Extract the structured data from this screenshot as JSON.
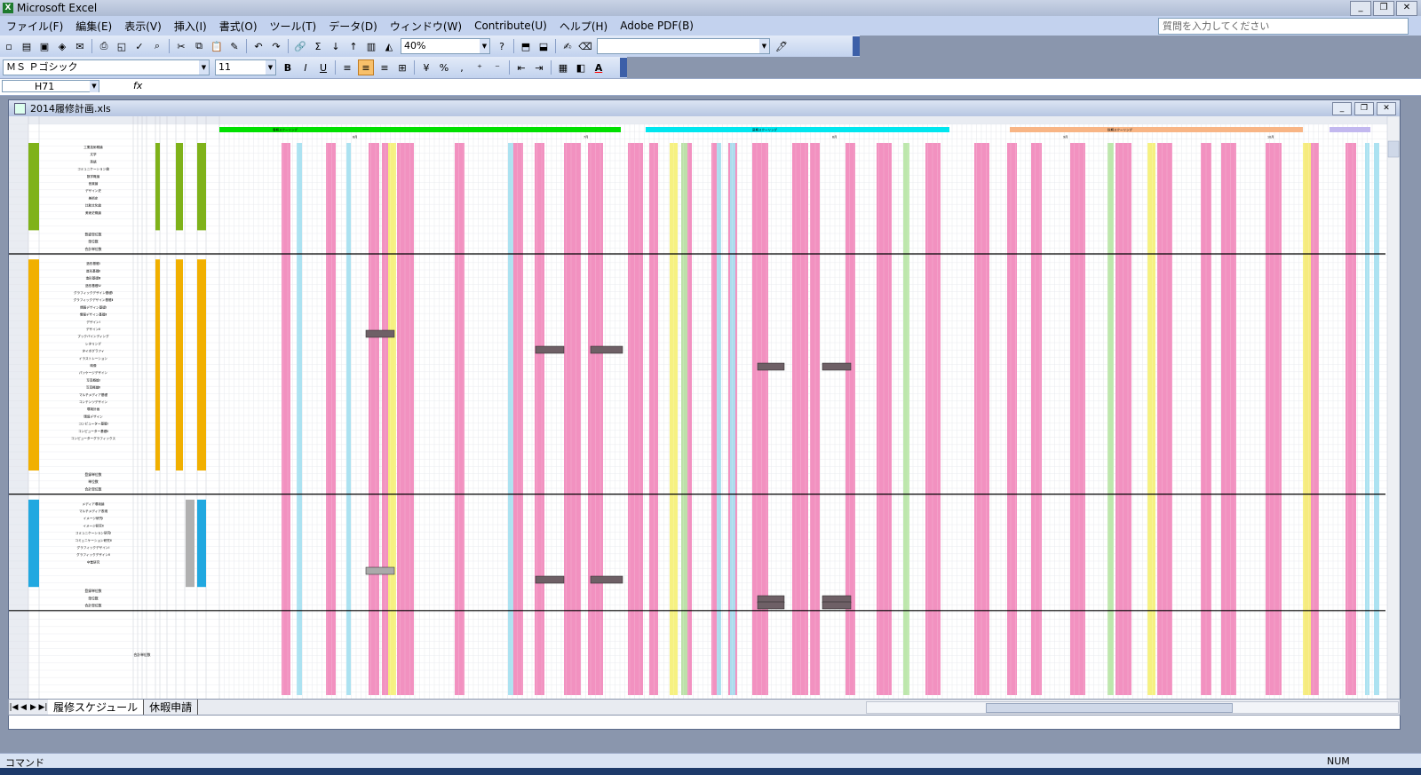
{
  "window": {
    "title": "Microsoft Excel",
    "app_icon": "X"
  },
  "menu": [
    "ファイル(F)",
    "編集(E)",
    "表示(V)",
    "挿入(I)",
    "書式(O)",
    "ツール(T)",
    "データ(D)",
    "ウィンドウ(W)",
    "Contribute(U)",
    "ヘルプ(H)",
    "Adobe PDF(B)"
  ],
  "help_placeholder": "質問を入力してください",
  "toolbar": {
    "zoom": "40%",
    "font_name": "ＭＳ Ｐゴシック",
    "font_size": "11",
    "bold": "B",
    "italic": "I",
    "underline": "U",
    "percent": "%",
    "comma": ","
  },
  "name_box": "H71",
  "fx_label": "fx",
  "workbook": {
    "title": "2014履修計画.xls"
  },
  "sheet_tabs": [
    "履修スケジュール",
    "休暇申請"
  ],
  "status": {
    "mode": "コマンド",
    "num": "NUM"
  },
  "colors": {
    "pink": "#f18bbd",
    "light_pink": "#f7c7dc",
    "green": "#00e000",
    "cyan": "#00e6ef",
    "orange": "#f8b585",
    "lavender": "#c2b8ef",
    "olive": "#7fb21a",
    "amber": "#f1b000",
    "blue": "#21a8e0",
    "yellow": "#f5f07a",
    "light_green": "#b9e6a8",
    "light_blue": "#a8e0f0"
  },
  "sheet": {
    "term_labels": [
      "春期スクーリング",
      "夏期スクーリング",
      "秋期スクーリング"
    ],
    "month_labels": [
      "6月",
      "7月",
      "8月",
      "9月",
      "10月"
    ],
    "sections": [
      {
        "color": "olive",
        "rows": [
          "工業技術概論",
          "文学",
          "英語",
          "コミュニケーション論",
          "数学概論",
          "音楽論",
          "デザイン史",
          "美術史",
          "比較文化論",
          "美術史概論"
        ],
        "summary": [
          "登録単位数",
          "単位数",
          "合計単位数"
        ]
      },
      {
        "color": "amber",
        "rows": [
          "造形基礎Ⅰ",
          "造形基礎Ⅱ",
          "造形基礎Ⅲ",
          "造形基礎Ⅳ",
          "グラフィックデザイン基礎Ⅰ",
          "グラフィックデザイン基礎Ⅱ",
          "情報デザイン基礎Ⅰ",
          "情報デザイン基礎Ⅱ",
          "デザインⅠ",
          "デザインⅡ",
          "ブックバインディング",
          "レタリング",
          "タイポグラフィ",
          "イラストレーション",
          "映像",
          "パッケージデザイン",
          "写真概論Ⅰ",
          "写真概論Ⅱ",
          "マルチメディア基礎",
          "コンテンツデザイン",
          "環境計画",
          "環境デザイン",
          "コンピューター基礎Ⅰ",
          "コンピューター基礎Ⅱ",
          "コンピューターグラフィックス"
        ],
        "summary": [
          "登録単位数",
          "単位数",
          "合計単位数"
        ]
      },
      {
        "color": "blue",
        "rows": [
          "メディア環境論",
          "マルチメディア表現",
          "イメージ研究Ⅰ",
          "イメージ研究Ⅱ",
          "コミュニケーション研究Ⅰ",
          "コミュニケーション研究Ⅱ",
          "グラフィックデザインⅠ",
          "グラフィックデザインⅡ",
          "卒業研究"
        ],
        "summary": [
          "登録単位数",
          "単位数",
          "合計単位数"
        ]
      }
    ]
  }
}
